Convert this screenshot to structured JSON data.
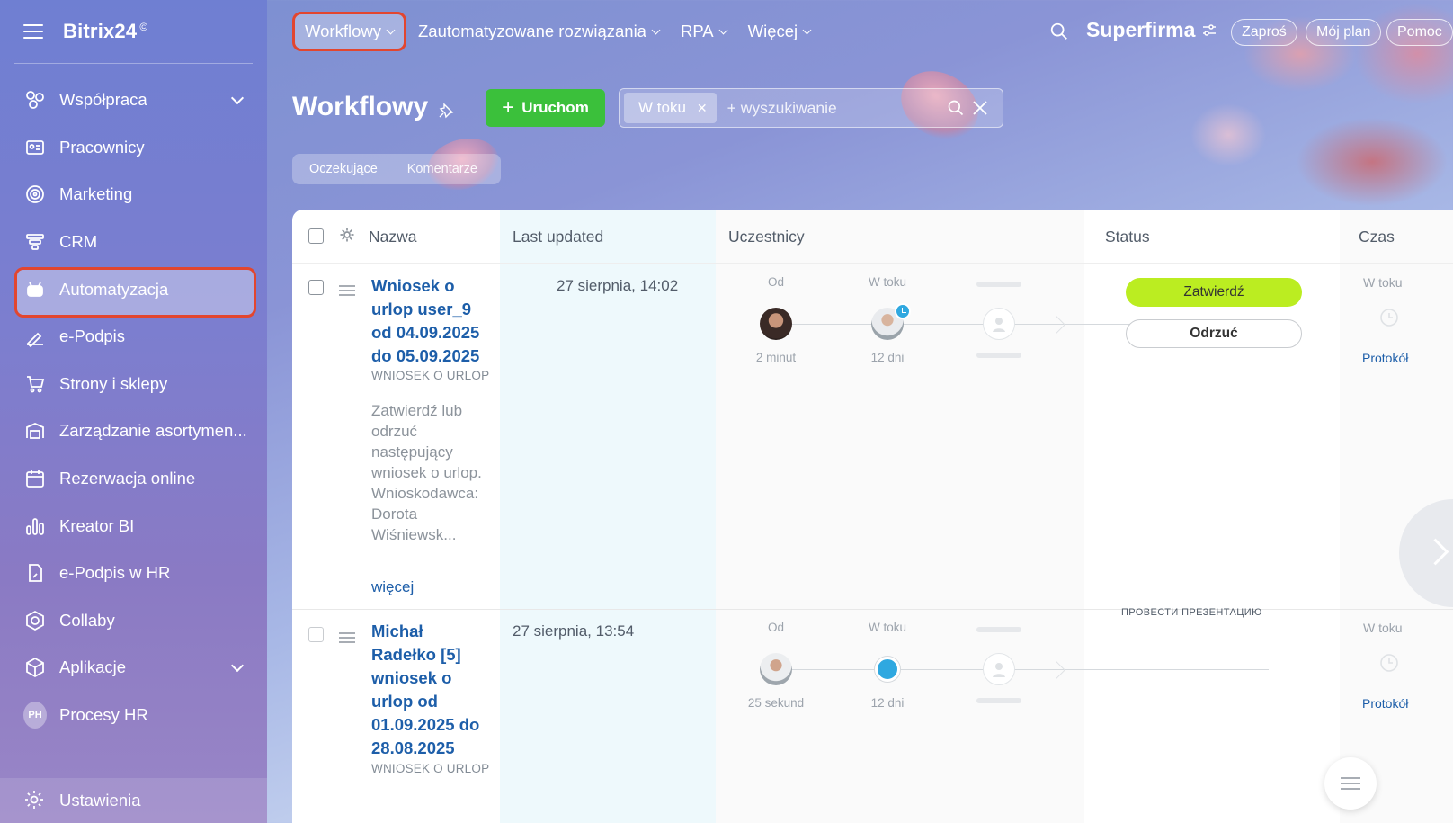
{
  "brand": {
    "name": "Bitrix24",
    "mark": "©"
  },
  "sidebar": {
    "items": [
      {
        "label": "Współpraca",
        "icon": "chat-bubbles-icon",
        "expand": true
      },
      {
        "label": "Pracownicy",
        "icon": "id-card-icon"
      },
      {
        "label": "Marketing",
        "icon": "target-icon"
      },
      {
        "label": "CRM",
        "icon": "funnel-icon"
      },
      {
        "label": "Automatyzacja",
        "icon": "robot-icon",
        "active": true
      },
      {
        "label": "e-Podpis",
        "icon": "pen-sign-icon"
      },
      {
        "label": "Strony i sklepy",
        "icon": "cart-icon"
      },
      {
        "label": "Zarządzanie asortymen...",
        "icon": "warehouse-icon"
      },
      {
        "label": "Rezerwacja online",
        "icon": "calendar-icon"
      },
      {
        "label": "Kreator BI",
        "icon": "bar-chart-icon"
      },
      {
        "label": "e-Podpis w HR",
        "icon": "document-sign-icon"
      },
      {
        "label": "Collaby",
        "icon": "hexagon-icon"
      },
      {
        "label": "Aplikacje",
        "icon": "box-icon",
        "expand": true
      },
      {
        "label": "Procesy HR",
        "badge": "PH"
      }
    ],
    "settings": "Ustawienia"
  },
  "topnav": {
    "items": [
      "Workflowy",
      "Zautomatyzowane rozwiązania",
      "RPA",
      "Więcej"
    ],
    "company": "Superfirma",
    "buttons": [
      "Zaproś",
      "Mój plan",
      "Pomoc"
    ]
  },
  "page": {
    "title": "Workflowy",
    "run_button": "Uruchom",
    "filter_chip": "W toku",
    "search_placeholder": "+ wyszukiwanie",
    "subtabs": [
      "Oczekujące",
      "Komentarze"
    ]
  },
  "table": {
    "headers": [
      "Nazwa",
      "Last updated",
      "Uczestnicy",
      "Status",
      "Czas"
    ],
    "rows": [
      {
        "name": "Wniosek o urlop user_9 od 04.09.2025 do 05.09.2025",
        "type": "WNIOSEK O URLOP",
        "description": "Zatwierdź lub odrzuć następujący wniosek o urlop. Wnioskodawca:  Dorota Wiśniewsk...",
        "more": "więcej",
        "updated": "27 sierpnia, 14:02",
        "stage_from": "Od",
        "stage_now": "W toku",
        "from_time": "2 minut",
        "now_time": "12 dni",
        "approve": "Zatwierdź",
        "reject": "Odrzuć",
        "time_status": "W toku",
        "protocol": "Protokół"
      },
      {
        "name": "Michał Radełko [5] wniosek o urlop od 01.09.2025 do 28.08.2025",
        "type": "WNIOSEK O URLOP",
        "updated": "27 sierpnia, 13:54",
        "stage_from": "Od",
        "stage_now": "W toku",
        "from_time": "25 sekund",
        "now_time": "12 dni",
        "task": "ПРОВЕСТИ ПРЕЗЕНТАЦИЮ",
        "time_status": "W toku",
        "protocol": "Protokół"
      }
    ]
  },
  "colors": {
    "accent_green": "#3bc03b",
    "approve": "#bbed21",
    "link": "#1d5ea9",
    "highlight": "#e2462f"
  }
}
